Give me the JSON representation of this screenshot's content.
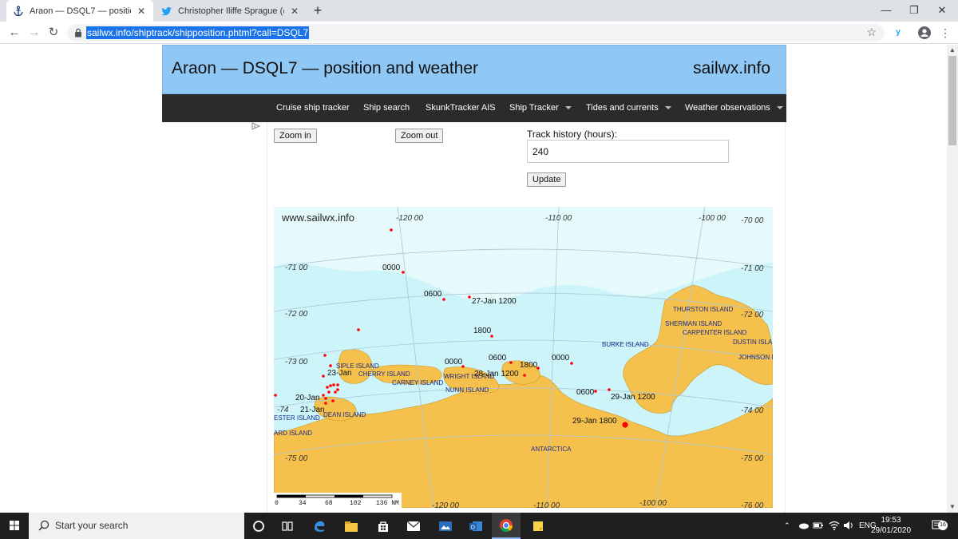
{
  "browser": {
    "tabs": [
      {
        "title": "Araon — DSQL7 — position and weather",
        "favicon": "anchor-icon",
        "active": true
      },
      {
        "title": "Christopher Iliffe Sprague (@cisprague",
        "favicon": "twitter-bird-icon",
        "active": false
      }
    ],
    "url": "sailwx.info/shiptrack/shipposition.phtml?call=DSQL7",
    "account_badge": "y"
  },
  "site": {
    "title": "Araon — DSQL7 — position and weather",
    "brand": "sailwx.info",
    "nav": [
      {
        "label": "Cruise ship tracker",
        "dropdown": false
      },
      {
        "label": "Ship search",
        "dropdown": false
      },
      {
        "label": "SkunkTracker AIS",
        "dropdown": false
      },
      {
        "label": "Ship Tracker",
        "dropdown": true
      },
      {
        "label": "Tides and currents",
        "dropdown": true
      },
      {
        "label": "Weather observations",
        "dropdown": true
      }
    ],
    "zoom_in_label": "Zoom in",
    "zoom_out_label": "Zoom out",
    "track_history_label": "Track history (hours):",
    "track_history_value": "240",
    "update_label": "Update"
  },
  "map": {
    "watermark": "www.sailwx.info",
    "lon_top": [
      "-120 00",
      "-110 00",
      "-100 00",
      "-70 00"
    ],
    "lon_bottom": [
      "-120 00",
      "-110 00",
      "-100 00",
      "-76 00"
    ],
    "lat_left": [
      "-71 00",
      "-72 00",
      "-73 00",
      "-74",
      "-75 00"
    ],
    "lat_right": [
      "-71 00",
      "-72 00",
      "-74 00",
      "-75 00"
    ],
    "islands": [
      "THURSTON ISLAND",
      "SHERMAN ISLAND",
      "CARPENTER ISLAND",
      "DUSTIN ISLAI",
      "JOHNSON I",
      "BURKE ISLAND",
      "SIPLE ISLAND",
      "CHERRY ISLAND",
      "CARNEY ISLAND",
      "WRIGHT ISLAND",
      "NUNN ISLAND",
      "DEAN ISLAND",
      "ESTER ISLAND",
      "ARD ISLAND",
      "ANTARCTICA"
    ],
    "track_labels": [
      "0000",
      "0600",
      "27-Jan 1200",
      "1800",
      "0000",
      "0600",
      "1800",
      "0000",
      "28-Jan 1200",
      "0600",
      "29-Jan 1200",
      "29-Jan 1800",
      "23-Jan",
      "20-Jan",
      "21-Jan"
    ],
    "scale": {
      "ticks": [
        "0",
        "34",
        "68",
        "102",
        "136 NM"
      ]
    },
    "colors": {
      "water": "#ccf4f9",
      "land": "#f5c04b",
      "ice": "#e6fafc",
      "track": "#ff0000"
    }
  },
  "taskbar": {
    "search_placeholder": "Start your search",
    "language": "ENG",
    "time": "19:53",
    "date": "29/01/2020",
    "notification_count": "16"
  }
}
